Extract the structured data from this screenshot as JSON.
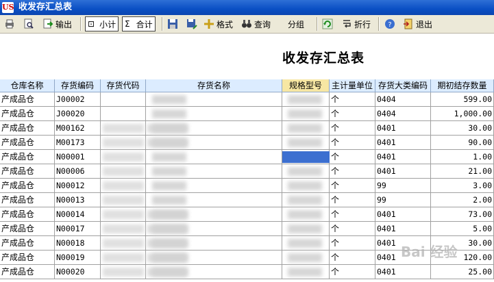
{
  "window": {
    "title": "收发存汇总表",
    "logo_text": "US"
  },
  "toolbar": {
    "output_label": "输出",
    "subtotal_label": "小计",
    "total_label": "合计",
    "format_label": "格式",
    "query_label": "查询",
    "group_label": "分组",
    "wrap_label": "折行",
    "exit_label": "退出",
    "sigma_glyph": "Σ",
    "subtotal_glyph": "⊡"
  },
  "report": {
    "title": "收发存汇总表",
    "columns": [
      "仓库名称",
      "存货编码",
      "存货代码",
      "存货名称",
      "规格型号",
      "主计量单位",
      "存货大类编码",
      "期初结存数量"
    ],
    "rows": [
      {
        "warehouse": "产成品仓",
        "code": "J00002",
        "unit": "个",
        "category": "0404",
        "qty": "599.00"
      },
      {
        "warehouse": "产成品仓",
        "code": "J00020",
        "unit": "个",
        "category": "0404",
        "qty": "1,000.00"
      },
      {
        "warehouse": "产成品仓",
        "code": "M00162",
        "unit": "个",
        "category": "0401",
        "qty": "30.00"
      },
      {
        "warehouse": "产成品仓",
        "code": "M00173",
        "unit": "个",
        "category": "0401",
        "qty": "90.00"
      },
      {
        "warehouse": "产成品仓",
        "code": "N00001",
        "unit": "个",
        "category": "0401",
        "qty": "1.00"
      },
      {
        "warehouse": "产成品仓",
        "code": "N00006",
        "unit": "个",
        "category": "0401",
        "qty": "21.00"
      },
      {
        "warehouse": "产成品仓",
        "code": "N00012",
        "unit": "个",
        "category": "99",
        "qty": "3.00"
      },
      {
        "warehouse": "产成品仓",
        "code": "N00013",
        "unit": "个",
        "category": "99",
        "qty": "2.00"
      },
      {
        "warehouse": "产成品仓",
        "code": "N00014",
        "unit": "个",
        "category": "0401",
        "qty": "73.00"
      },
      {
        "warehouse": "产成品仓",
        "code": "N00017",
        "unit": "个",
        "category": "0401",
        "qty": "5.00"
      },
      {
        "warehouse": "产成品仓",
        "code": "N00018",
        "unit": "个",
        "category": "0401",
        "qty": "30.00"
      },
      {
        "warehouse": "产成品仓",
        "code": "N00019",
        "unit": "个",
        "category": "0401",
        "qty": "120.00"
      },
      {
        "warehouse": "产成品仓",
        "code": "N00020",
        "unit": "个",
        "category": "0401",
        "qty": "25.00"
      }
    ]
  },
  "watermark": {
    "text": "Bai 经验"
  },
  "colors": {
    "titlebar": "#0a4fc4",
    "header_bg": "#dcecff",
    "header_selected": "#f7e7a3",
    "selection": "#3c6fd0"
  }
}
